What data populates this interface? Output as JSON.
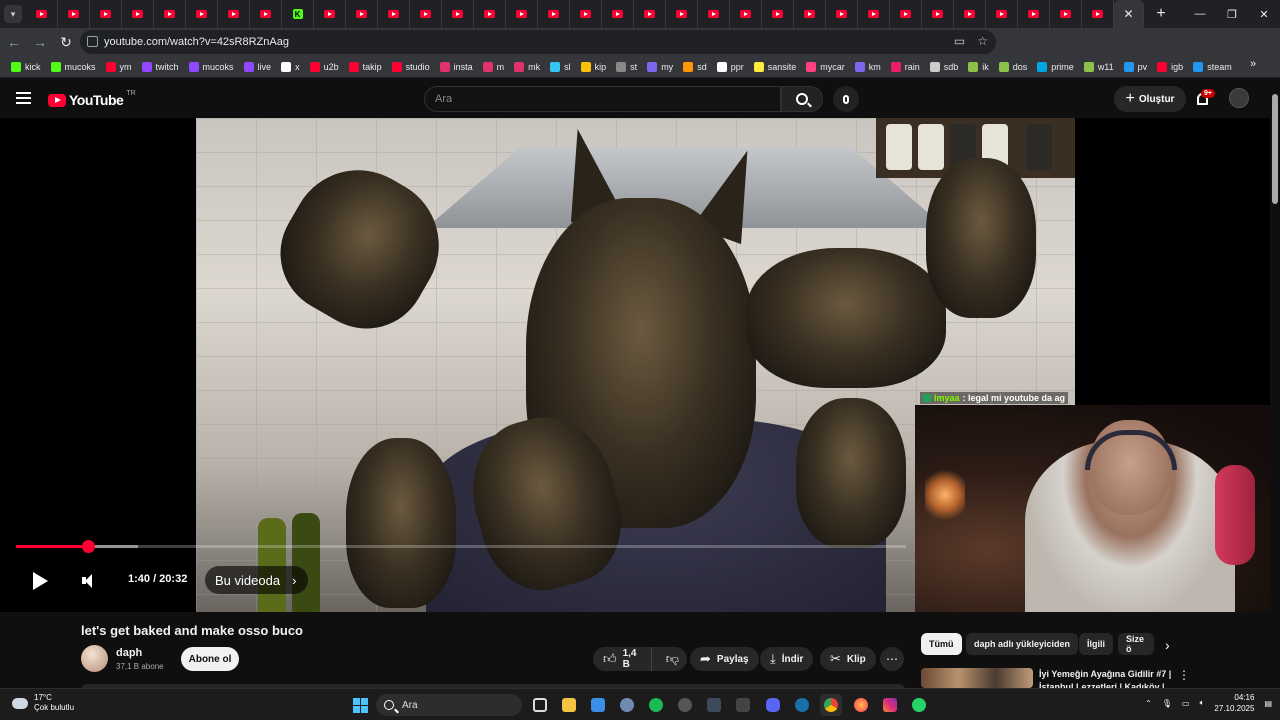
{
  "browser": {
    "url": "youtube.com/watch?v=42sR8RZnAag",
    "bookmarks": [
      "kick",
      "mucoks",
      "ym",
      "twitch",
      "mucoks",
      "live",
      "x",
      "u2b",
      "takip",
      "studio",
      "insta",
      "m",
      "mk",
      "sl",
      "kip",
      "st",
      "my",
      "sd",
      "ppr",
      "sansite",
      "mycar",
      "km",
      "rain",
      "sdb",
      "ik",
      "dos",
      "prime",
      "w11",
      "pv",
      "igb",
      "steam"
    ]
  },
  "youtube": {
    "logo_text": "YouTube",
    "region": "TR",
    "search_placeholder": "Ara",
    "create_label": "Oluştur",
    "notif_badge": "9+"
  },
  "player": {
    "current_time": "1:40",
    "duration": "20:32",
    "time_display": "1:40 / 20:32",
    "chapter_label": "Bu videoda",
    "progress_fraction": 0.081,
    "buffered_fraction": 0.137,
    "chat_user": "lmyaa",
    "chat_text": ": legal mi youtube da ag"
  },
  "video": {
    "title": "let's get baked and make osso buco",
    "channel": "daph",
    "subscribers": "37,1 B abone",
    "subscribe_label": "Abone ol",
    "likes": "1,4 B",
    "share_label": "Paylaş",
    "download_label": "İndir",
    "clip_label": "Klip"
  },
  "sidebar": {
    "chips": [
      "Tümü",
      "daph adlı yükleyiciden",
      "İlgili",
      "Size ö"
    ],
    "rec_title": "İyi Yemeğin Ayağına Gidilir #7 | İstanbul Lezzetleri | Kadıköy |"
  },
  "taskbar": {
    "temp": "17°C",
    "condition": "Çok bulutlu",
    "search": "Ara",
    "time": "04:16",
    "date": "27.10.2025"
  }
}
